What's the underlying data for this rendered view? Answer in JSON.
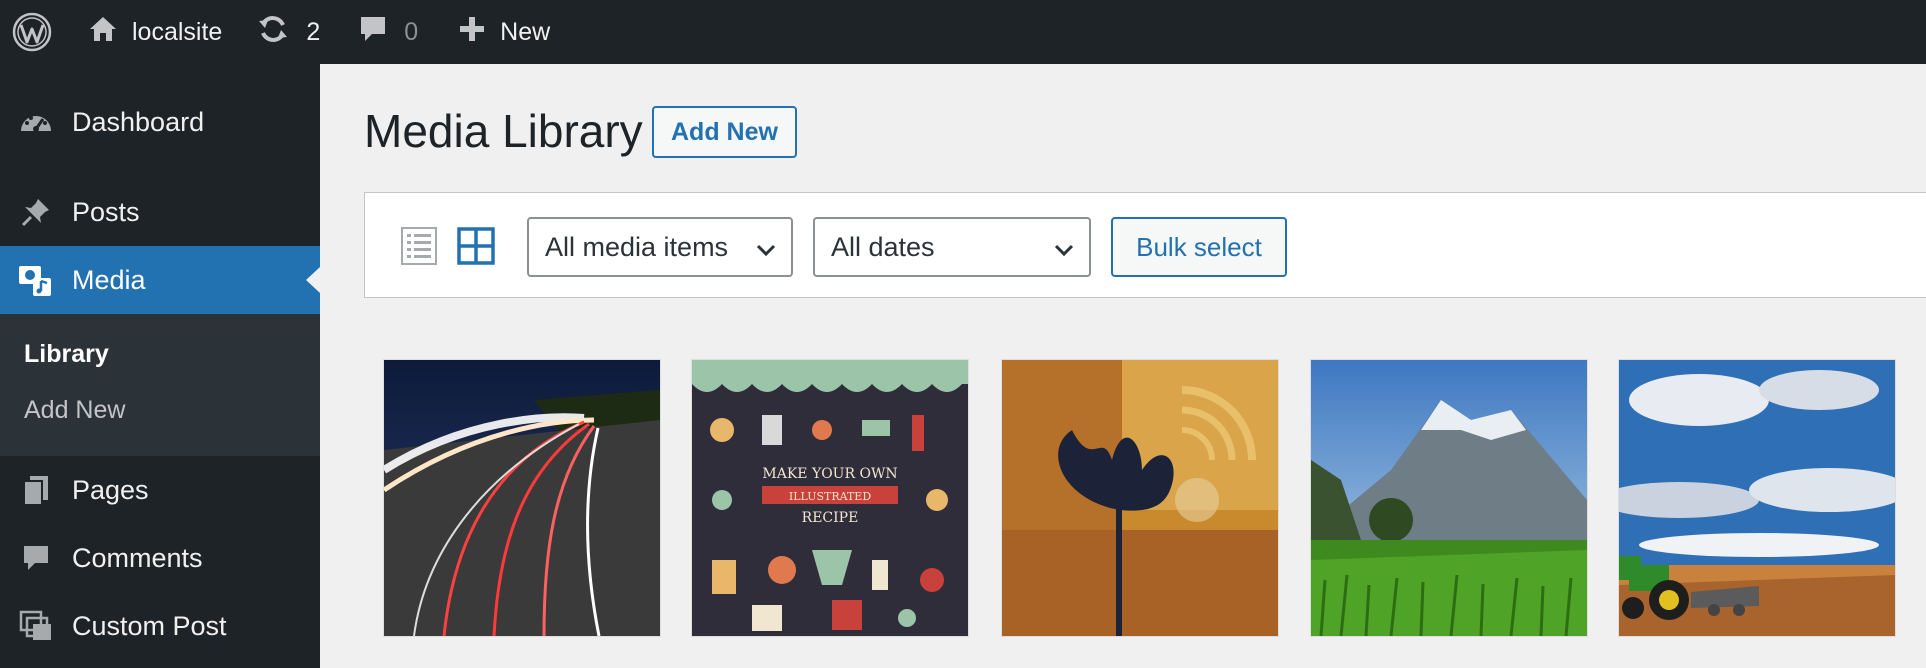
{
  "admin_bar": {
    "site_name": "localsite",
    "updates_count": "2",
    "comments_count": "0",
    "new_label": "New"
  },
  "sidebar": {
    "items": [
      {
        "label": "Dashboard",
        "icon": "dashboard-icon"
      },
      {
        "label": "Posts",
        "icon": "pin-icon"
      },
      {
        "label": "Media",
        "icon": "media-icon",
        "current": true
      },
      {
        "label": "Pages",
        "icon": "pages-icon"
      },
      {
        "label": "Comments",
        "icon": "comment-icon"
      },
      {
        "label": "Custom Post",
        "icon": "custom-post-icon"
      }
    ],
    "submenu": [
      {
        "label": "Library",
        "active": true
      },
      {
        "label": "Add New"
      }
    ]
  },
  "page": {
    "title": "Media Library",
    "add_new_label": "Add New"
  },
  "toolbar": {
    "type_filter": "All media items",
    "date_filter": "All dates",
    "bulk_select_label": "Bulk select"
  },
  "media_items": [
    {
      "description": "highway-light-trails",
      "icon": "image-thumbnail"
    },
    {
      "description": "illustrated-recipe-poster",
      "icon": "image-thumbnail"
    },
    {
      "description": "abstract-ginkgo-art",
      "icon": "image-thumbnail"
    },
    {
      "description": "mountain-meadow",
      "icon": "image-thumbnail"
    },
    {
      "description": "tractor-field-sky",
      "icon": "image-thumbnail"
    }
  ],
  "colors": {
    "admin_bar_bg": "#1d2327",
    "accent": "#2271b1",
    "submenu_bg": "#2c3338",
    "page_bg": "#f0f0f1"
  }
}
